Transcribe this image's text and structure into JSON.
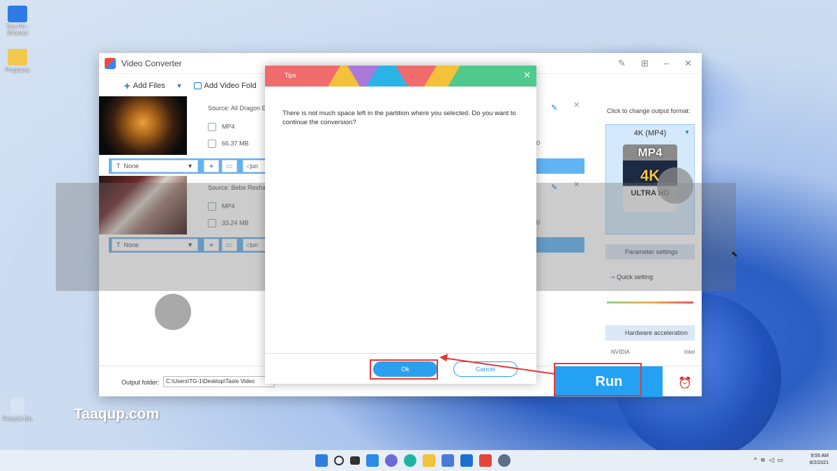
{
  "desktop": {
    "icons": [
      {
        "label": "This PC - Shortcut",
        "color": "#2d7be6"
      },
      {
        "label": "Programs",
        "color": "#f2c94c"
      },
      {
        "label": "Recycle Bin",
        "color": "#d7e4f3"
      }
    ],
    "site_watermark": "Taaqup.com"
  },
  "app": {
    "title": "Video Converter",
    "toolbar": {
      "add_files": "Add Files",
      "add_folder": "Add Video Fold"
    },
    "files": [
      {
        "source": "Source: All Dragon E",
        "format": "MP4",
        "size": "66.37 MB",
        "resolution": "60",
        "subtitle": "None",
        "audio": "un"
      },
      {
        "source": "Source: Bebe Rexha",
        "format": "MP4",
        "size": "33.24 MB",
        "resolution": "60",
        "subtitle": "None",
        "audio": "un"
      }
    ],
    "right_panel": {
      "hint": "Click to change output format:",
      "format_name": "4K (MP4)",
      "format_badge": {
        "top": "MP4",
        "mid": "4K",
        "bottom": "ULTRA HD"
      },
      "parameter_settings": "Parameter settings",
      "quick_setting": "Quick setting",
      "hardware_acceleration": "Hardware acceleration",
      "nvidia": "NVIDIA",
      "intel": "Intel"
    },
    "footer": {
      "output_label": "Output folder:",
      "output_path": "C:\\Users\\TG-1\\Desktop\\Taste Video",
      "run": "Run"
    }
  },
  "dialog": {
    "title": "Tips",
    "message": "There is not much space left in the partition where you selected. Do you want to continue the conversion?",
    "ok": "Ok",
    "cancel": "Cancel",
    "stripe_colors": [
      "#f3c13a",
      "#a97ad9",
      "#2bb3e8",
      "#f06b6b",
      "#f3c13a",
      "#4fc98c"
    ]
  },
  "taskbar": {
    "icons": [
      "windows-icon",
      "search-icon",
      "task-view-icon",
      "widgets-icon",
      "chat-icon",
      "edge-icon",
      "explorer-icon",
      "store-icon",
      "mail-icon",
      "office-icon",
      "settings-icon"
    ],
    "time": "9:55 AM",
    "date": "8/2/2021"
  }
}
